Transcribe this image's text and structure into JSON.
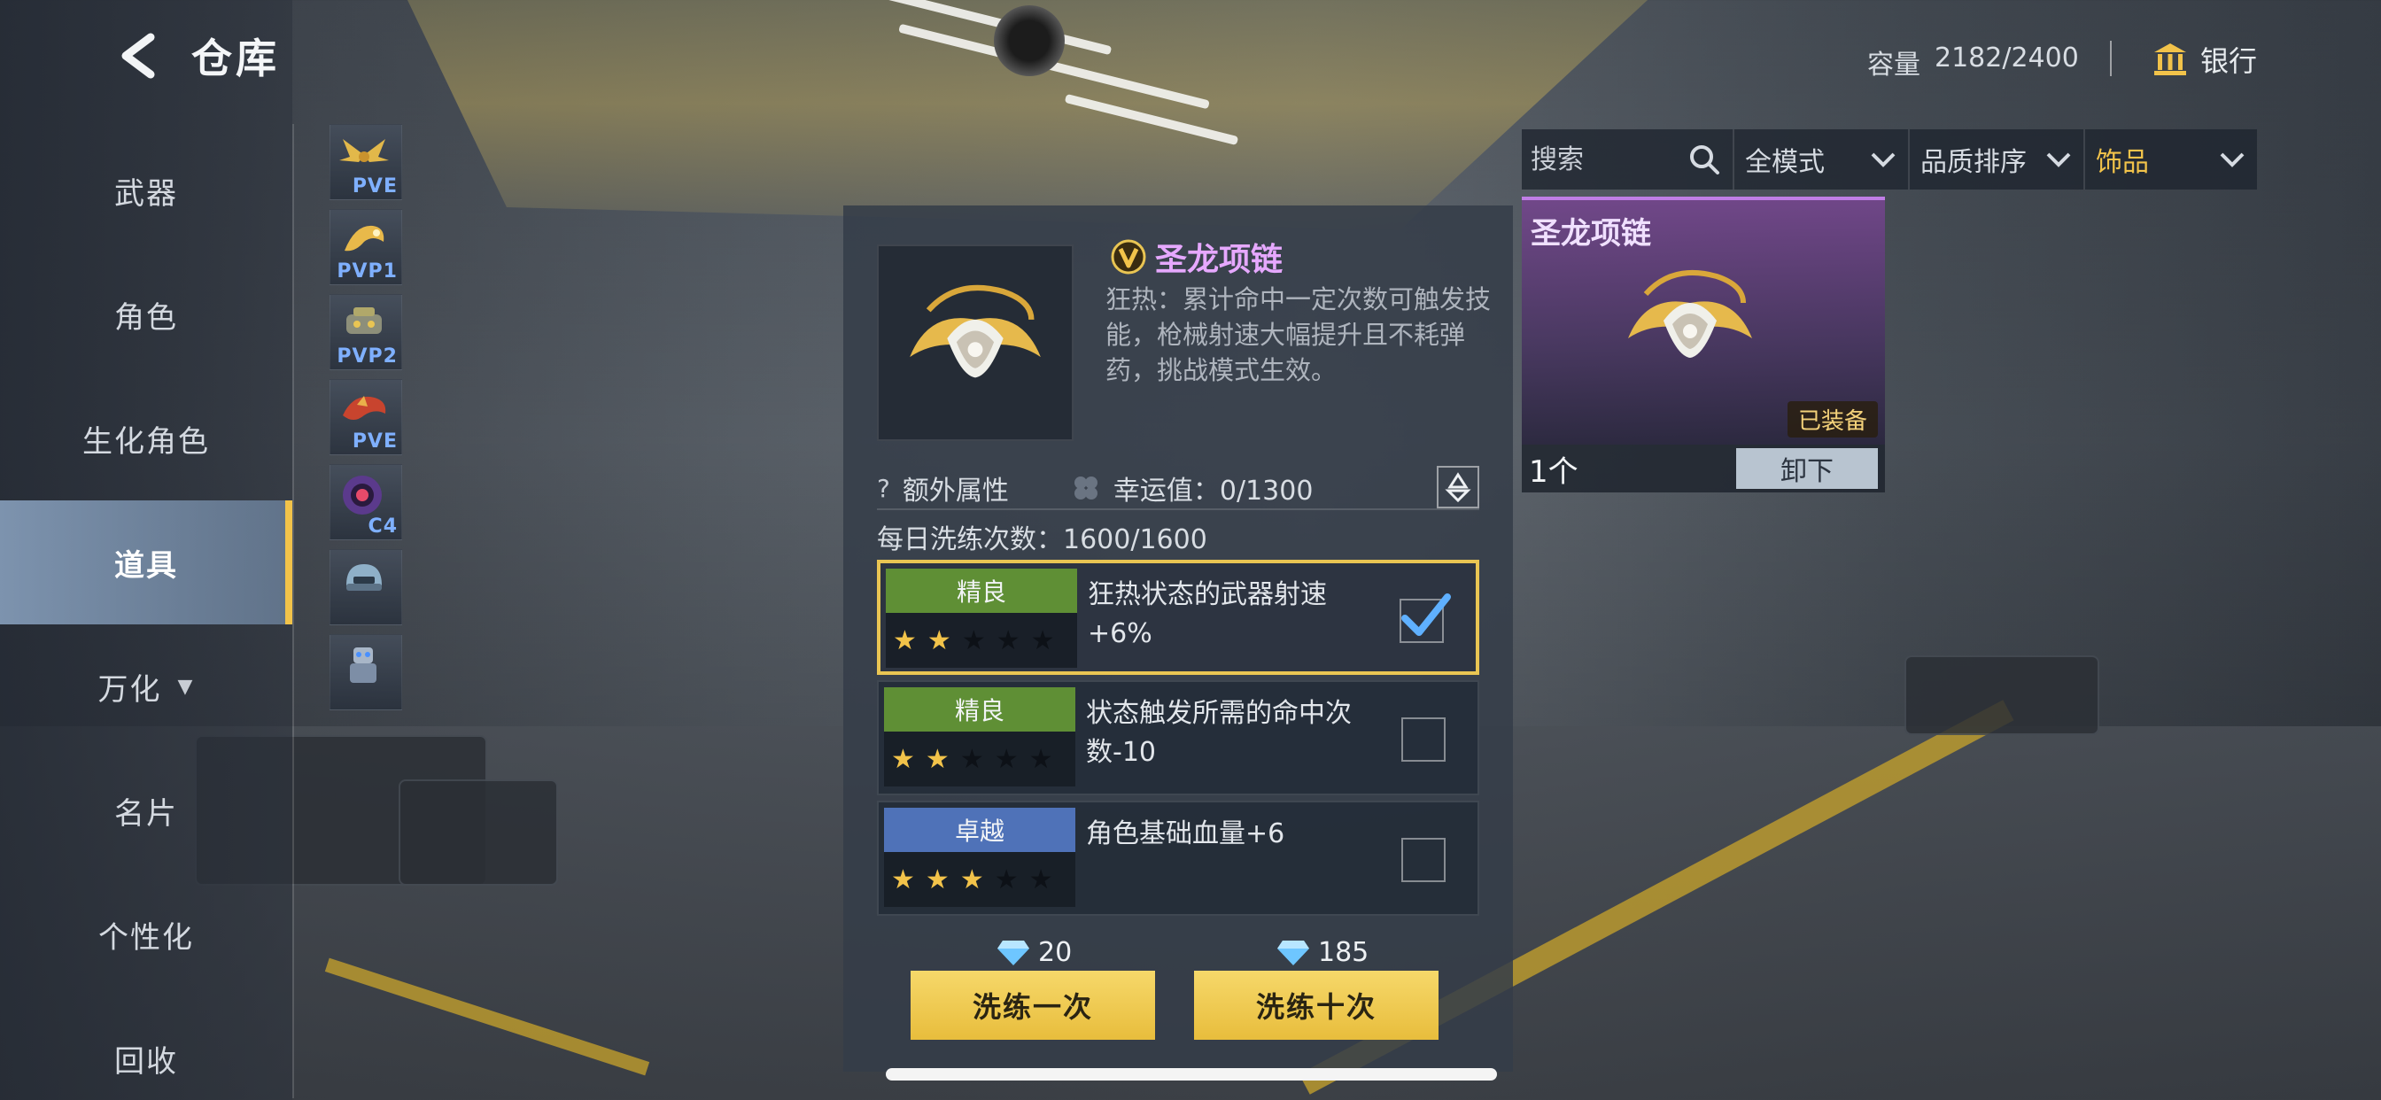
{
  "header": {
    "title": "仓库",
    "back_icon": "back-arrow-icon"
  },
  "nav": {
    "items": [
      {
        "label": "武器"
      },
      {
        "label": "角色"
      },
      {
        "label": "生化角色"
      },
      {
        "label": "道具",
        "active": true
      },
      {
        "label": "万化"
      },
      {
        "label": "名片"
      },
      {
        "label": "个性化"
      },
      {
        "label": "回收"
      }
    ]
  },
  "strip": {
    "items": [
      {
        "tag": "PVE",
        "icon": "wings-icon"
      },
      {
        "tag": "PVP1",
        "icon": "golden-dragon-icon"
      },
      {
        "tag": "PVP2",
        "icon": "mechanical-creature-icon"
      },
      {
        "tag": "PVE",
        "icon": "red-dragon-icon"
      },
      {
        "tag": "C4",
        "icon": "c4-device-icon"
      },
      {
        "tag": "",
        "icon": "helmet-icon"
      },
      {
        "tag": "",
        "icon": "robot-icon"
      }
    ]
  },
  "capacity": {
    "label": "容量",
    "value": "2182/2400"
  },
  "bank": {
    "label": "银行",
    "icon": "bank-icon"
  },
  "filters": {
    "search_placeholder": "搜索",
    "mode": "全模式",
    "sort": "品质排序",
    "category": "饰品"
  },
  "equipped": {
    "name": "圣龙项链",
    "badge": "已装备",
    "count": "1个",
    "unequip_label": "卸下"
  },
  "detail": {
    "name": "圣龙项链",
    "description": "狂热：累计命中一定次数可触发技能，枪械射速大幅提升且不耗弹药，挑战模式生效。",
    "extra_attr_label": "额外属性",
    "luck_label": "幸运值：0/1300",
    "daily_label": "每日洗练次数：1600/1600"
  },
  "options": [
    {
      "grade": "精良",
      "stars": 2,
      "max_stars": 5,
      "text": "狂热状态的武器射速+6%",
      "checked": true
    },
    {
      "grade": "精良",
      "stars": 2,
      "max_stars": 5,
      "text": "状态触发所需的命中次数-10",
      "checked": false
    },
    {
      "grade": "卓越",
      "stars": 3,
      "max_stars": 5,
      "text": "角色基础血量+6",
      "checked": false
    }
  ],
  "actions": {
    "refine_once": {
      "cost": "20",
      "label": "洗练一次"
    },
    "refine_ten": {
      "cost": "185",
      "label": "洗练十次"
    }
  },
  "colors": {
    "accent_gold": "#f2c34a",
    "grade_good": "#5f8f35",
    "grade_great": "#4f72b8",
    "item_name": "#e6a8ff"
  }
}
